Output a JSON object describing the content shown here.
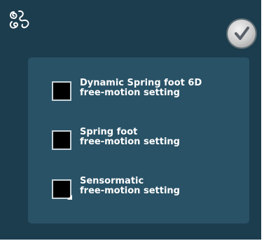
{
  "header": {
    "icon": "free-motion-icon",
    "ok_icon": "checkmark-icon"
  },
  "options": [
    {
      "line1": "Dynamic Spring foot 6D",
      "line2": "free-motion setting",
      "checked": false
    },
    {
      "line1": "Spring foot",
      "line2": "free-motion setting",
      "checked": false
    },
    {
      "line1": "Sensormatic",
      "line2": "free-motion setting",
      "checked": false
    }
  ],
  "colors": {
    "background": "#1c3d4e",
    "panel": "#295266",
    "text": "#ffffff",
    "checkbox_fill": "#000000"
  }
}
